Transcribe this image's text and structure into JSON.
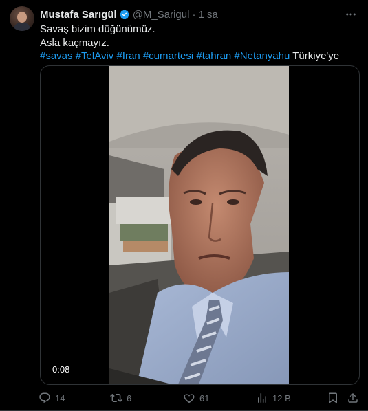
{
  "tweet": {
    "author_name": "Mustafa Sarıgül",
    "handle": "@M_Sarigul",
    "separator": "·",
    "time": "1 sa",
    "text_line1": "Savaş bizim düğünümüz.",
    "text_line2": "Asla kaçmayız.",
    "hashtags": [
      "#savas",
      "#TelAviv",
      "#Iran",
      "#cumartesi",
      "#tahran",
      "#Netanyahu"
    ],
    "trailing_text": "Türkiye'ye"
  },
  "media": {
    "timecode": "0:08"
  },
  "actions": {
    "replies": "14",
    "reposts": "6",
    "likes": "61",
    "views": "12 B"
  },
  "icons": [
    "verified-badge-icon",
    "more-icon",
    "reply-icon",
    "repost-icon",
    "like-icon",
    "views-icon",
    "bookmark-icon",
    "share-icon"
  ],
  "colors": {
    "background": "#000000",
    "text": "#e7e9ea",
    "secondary": "#71767b",
    "link": "#1d9bf0"
  }
}
